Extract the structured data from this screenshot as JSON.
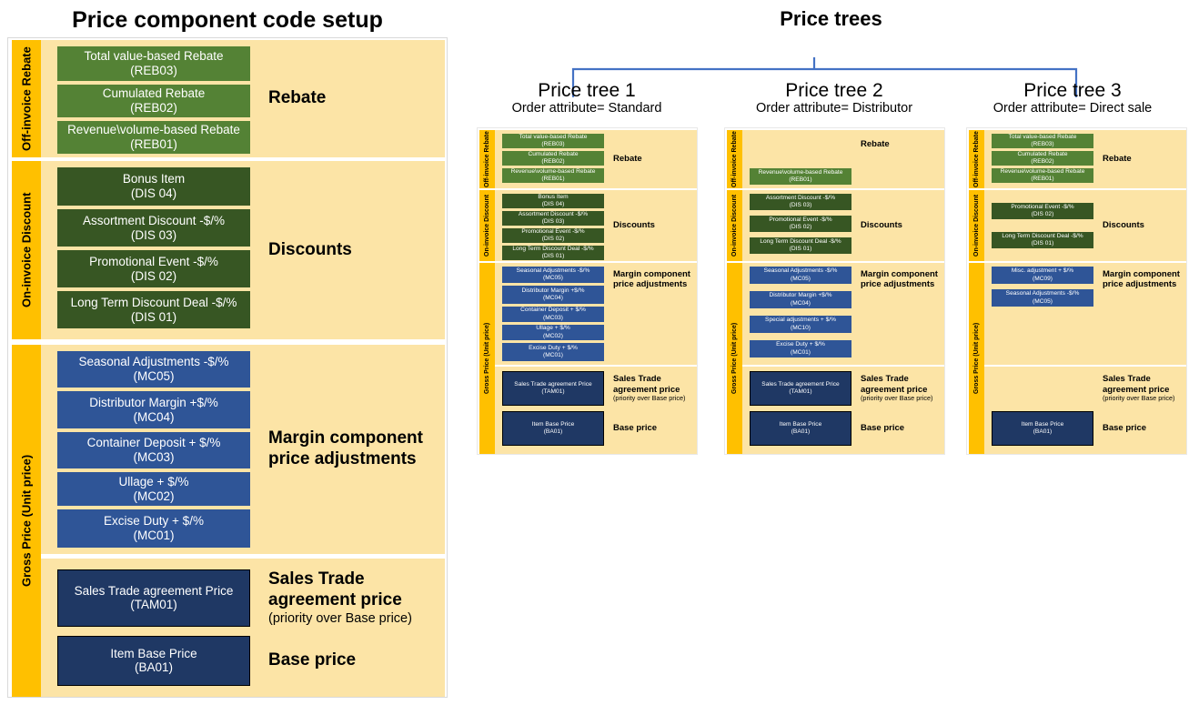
{
  "titles": {
    "left": "Price component code setup",
    "right": "Price trees"
  },
  "colors": {
    "rail_yellow": "#FFC000",
    "band_background": "#FCE4A6",
    "rebate_green": "#548235",
    "discount_green": "#375623",
    "margin_blue": "#2F5597",
    "price_navy": "#1F3864",
    "brace_blue": "#4472C4"
  },
  "setup": {
    "bands": [
      {
        "rail": "Off-invoice Rebate",
        "caption": "Rebate",
        "caption_sub": "",
        "box_style": "rebate_green",
        "items": [
          {
            "name": "Total value-based Rebate",
            "code": "(REB03)"
          },
          {
            "name": "Cumulated Rebate",
            "code": "(REB02)"
          },
          {
            "name": "Revenue\\volume-based Rebate",
            "code": "(REB01)"
          }
        ]
      },
      {
        "rail": "On-invoice Discount",
        "caption": "Discounts",
        "caption_sub": "",
        "box_style": "discount_green",
        "items": [
          {
            "name": "Bonus Item",
            "code": "(DIS 04)"
          },
          {
            "name": "Assortment Discount -$/%",
            "code": "(DIS 03)"
          },
          {
            "name": "Promotional Event -$/%",
            "code": "(DIS 02)"
          },
          {
            "name": "Long Term Discount Deal -$/%",
            "code": "(DIS 01)"
          }
        ]
      },
      {
        "rail": "Gross Price (Unit price)",
        "caption": "Margin component price adjustments",
        "caption_sub": "",
        "box_style": "margin_blue",
        "items": [
          {
            "name": "Seasonal Adjustments -$/%",
            "code": "(MC05)"
          },
          {
            "name": "Distributor Margin +$/%",
            "code": "(MC04)"
          },
          {
            "name": "Container Deposit + $/%",
            "code": "(MC03)"
          },
          {
            "name": "Ullage + $/%",
            "code": "(MC02)"
          },
          {
            "name": "Excise Duty + $/%",
            "code": "(MC01)"
          }
        ]
      },
      {
        "rail": "",
        "caption": "Sales Trade agreement price",
        "caption_sub": "(priority over Base price)",
        "box_style": "price_navy",
        "items": [
          {
            "name": "Sales Trade agreement Price",
            "code": "(TAM01)"
          }
        ]
      },
      {
        "rail": "",
        "caption": "Base price",
        "caption_sub": "",
        "box_style": "price_navy",
        "items": [
          {
            "name": "Item Base Price",
            "code": "(BA01)"
          }
        ]
      }
    ]
  },
  "trees": [
    {
      "name": "Price tree 1",
      "attribute": "Order attribute= Standard",
      "bands": [
        {
          "rail": "Off-invoice Rebate",
          "caption": "Rebate",
          "caption_sub": "",
          "box_style": "rebate_green",
          "items": [
            {
              "name": "Total value-based Rebate",
              "code": "(REB03)"
            },
            {
              "name": "Cumulated Rebate",
              "code": "(REB02)"
            },
            {
              "name": "Revenue\\volume-based Rebate",
              "code": "(REB01)"
            }
          ]
        },
        {
          "rail": "On-invoice Discount",
          "caption": "Discounts",
          "caption_sub": "",
          "box_style": "discount_green",
          "items": [
            {
              "name": "Bonus Item",
              "code": "(DIS 04)"
            },
            {
              "name": "Assortment Discount -$/%",
              "code": "(DIS 03)"
            },
            {
              "name": "Promotional Event -$/%",
              "code": "(DIS 02)"
            },
            {
              "name": "Long Term Discount Deal -$/%",
              "code": "(DIS 01)"
            }
          ]
        },
        {
          "rail": "Gross Price (Unit price)",
          "caption": "Margin component price adjustments",
          "caption_sub": "",
          "box_style": "margin_blue",
          "items": [
            {
              "name": "Seasonal Adjustments -$/%",
              "code": "(MC05)"
            },
            {
              "name": "Distributor Margin +$/%",
              "code": "(MC04)"
            },
            {
              "name": "Container Deposit + $/%",
              "code": "(MC03)"
            },
            {
              "name": "Ullage + $/%",
              "code": "(MC02)"
            },
            {
              "name": "Excise Duty + $/%",
              "code": "(MC01)"
            }
          ]
        },
        {
          "rail": "",
          "caption": "Sales Trade agreement price",
          "caption_sub": "(priority over Base price)",
          "box_style": "price_navy",
          "items": [
            {
              "name": "Sales Trade agreement Price",
              "code": "(TAM01)"
            }
          ]
        },
        {
          "rail": "",
          "caption": "Base price",
          "caption_sub": "",
          "box_style": "price_navy",
          "items": [
            {
              "name": "Item Base Price",
              "code": "(BA01)"
            }
          ]
        }
      ]
    },
    {
      "name": "Price tree 2",
      "attribute": "Order attribute= Distributor",
      "bands": [
        {
          "rail": "Off-invoice Rebate",
          "caption": "Rebate",
          "caption_sub": "",
          "box_style": "rebate_green",
          "items": [
            {
              "name": "Revenue\\volume-based Rebate",
              "code": "(REB01)"
            }
          ]
        },
        {
          "rail": "On-invoice Discount",
          "caption": "Discounts",
          "caption_sub": "",
          "box_style": "discount_green",
          "items": [
            {
              "name": "Assortment Discount -$/%",
              "code": "(DIS 03)"
            },
            {
              "name": "Promotional Event -$/%",
              "code": "(DIS 02)"
            },
            {
              "name": "Long Term Discount Deal -$/%",
              "code": "(DIS 01)"
            }
          ]
        },
        {
          "rail": "Gross Price (Unit price)",
          "caption": "Margin component price adjustments",
          "caption_sub": "",
          "box_style": "margin_blue",
          "items": [
            {
              "name": "Seasonal Adjustments -$/%",
              "code": "(MC05)"
            },
            {
              "name": "Distributor Margin +$/%",
              "code": "(MC04)"
            },
            {
              "name": "Special adjustments + $/%",
              "code": "(MC10)"
            },
            {
              "name": "Excise Duty + $/%",
              "code": "(MC01)"
            }
          ]
        },
        {
          "rail": "",
          "caption": "Sales Trade agreement price",
          "caption_sub": "(priority over Base price)",
          "box_style": "price_navy",
          "items": [
            {
              "name": "Sales Trade agreement Price",
              "code": "(TAM01)"
            }
          ]
        },
        {
          "rail": "",
          "caption": "Base price",
          "caption_sub": "",
          "box_style": "price_navy",
          "items": [
            {
              "name": "Item Base Price",
              "code": "(BA01)"
            }
          ]
        }
      ]
    },
    {
      "name": "Price tree 3",
      "attribute": "Order attribute= Direct sale",
      "bands": [
        {
          "rail": "Off-invoice Rebate",
          "caption": "Rebate",
          "caption_sub": "",
          "box_style": "rebate_green",
          "items": [
            {
              "name": "Total value-based Rebate",
              "code": "(REB03)"
            },
            {
              "name": "Cumulated Rebate",
              "code": "(REB02)"
            },
            {
              "name": "Revenue\\volume-based Rebate",
              "code": "(REB01)"
            }
          ]
        },
        {
          "rail": "On-invoice Discount",
          "caption": "Discounts",
          "caption_sub": "",
          "box_style": "discount_green",
          "items": [
            {
              "name": "Promotional Event -$/%",
              "code": "(DIS 02)"
            },
            {
              "name": "Long Term Discount Deal -$/%",
              "code": "(DIS 01)"
            }
          ]
        },
        {
          "rail": "Gross Price (Unit price)",
          "caption": "Margin component price adjustments",
          "caption_sub": "",
          "box_style": "margin_blue",
          "items": [
            {
              "name": "Misc. adjustment + $/%",
              "code": "(MC09)"
            },
            {
              "name": "Seasonal Adjustments -$/%",
              "code": "(MC05)"
            }
          ]
        },
        {
          "rail": "",
          "caption": "Sales Trade agreement price",
          "caption_sub": "(priority over Base price)",
          "box_style": "price_navy",
          "items": []
        },
        {
          "rail": "",
          "caption": "Base price",
          "caption_sub": "",
          "box_style": "price_navy",
          "items": [
            {
              "name": "Item Base Price",
              "code": "(BA01)"
            }
          ]
        }
      ]
    }
  ]
}
